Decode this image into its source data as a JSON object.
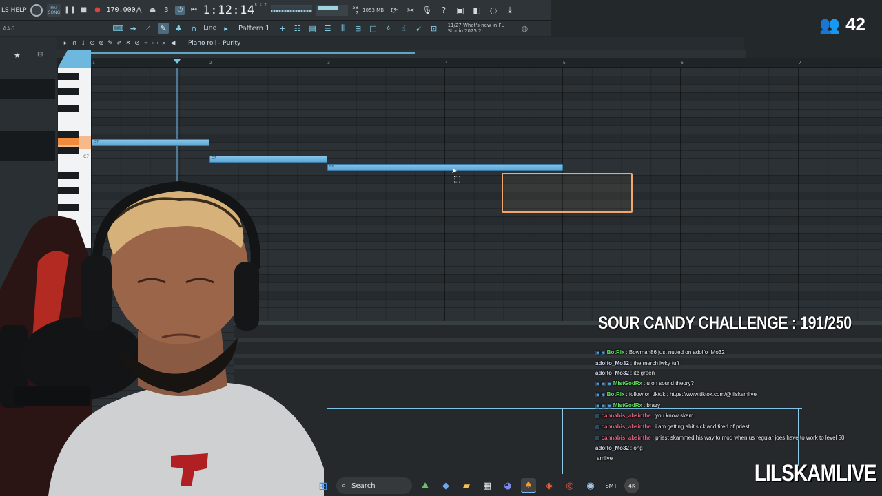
{
  "overlay": {
    "viewer_count": "42",
    "challenge": "SOUR CANDY CHALLENGE : 191/250",
    "brand": "LILSKAMLIVE"
  },
  "fl": {
    "menu_help": "LS HELP",
    "pat_label": "PAT",
    "song_label": "SONG",
    "tempo": "170.000",
    "time": "1:12:14",
    "time_unit": "B:S:T",
    "cpu_value": "58",
    "ram_value": "1053 MB",
    "polyphony": "7",
    "note_indicator": "A#6",
    "snap": "Line",
    "pattern": "Pattern 1",
    "news_date": "11/27",
    "news_line1": "What's new in FL",
    "news_line2": "Studio 2025.2",
    "piano_roll_title": "Piano roll - Purity"
  },
  "ruler": [
    "1",
    "2",
    "3",
    "4",
    "5",
    "6",
    "7"
  ],
  "keyboard": {
    "label_c7": "C7"
  },
  "notes": [
    {
      "label": "D7"
    },
    {
      "label": "C7"
    },
    {
      "label": "B6"
    }
  ],
  "chat": [
    {
      "badges": "▣ ◉",
      "user": "BotRix",
      "color": "#5ee35e",
      "msg": ": Bowman86 just nutted on adolfo_Mo32"
    },
    {
      "badges": "",
      "user": "adolfo_Mo32",
      "color": "#cdd3e8",
      "msg": ": the merch lwky tuff"
    },
    {
      "badges": "",
      "user": "adolfo_Mo32",
      "color": "#cdd3e8",
      "msg": ": itz green"
    },
    {
      "badges": "▣ ▣ ▣",
      "user": "MistGodRx",
      "color": "#5ee35e",
      "msg": ": u on sound theory?"
    },
    {
      "badges": "▣ ◉",
      "user": "BotRix",
      "color": "#5ee35e",
      "msg": ": follow on tiktok : https://www.tiktok.com/@lilskamlive"
    },
    {
      "badges": "▣ ▣ ▣",
      "user": "MistGodRx",
      "color": "#5ee35e",
      "msg": ": brazy"
    },
    {
      "badges": "▤",
      "user": "cannabis_absinthe",
      "color": "#e0607e",
      "msg": ": you know skam"
    },
    {
      "badges": "▤",
      "user": "cannabis_absinthe",
      "color": "#e0607e",
      "msg": ": i am getting abit sick and tired of priest"
    },
    {
      "badges": "▤",
      "user": "cannabis_absinthe",
      "color": "#e0607e",
      "msg": ": priest skammed his way to mod when us regular joes have to work to level 50"
    },
    {
      "badges": "",
      "user": "adolfo_Mo32",
      "color": "#cdd3e8",
      "msg": ": ong"
    },
    {
      "badges": "",
      "user": "",
      "color": "#ffffff",
      "msg": "amlive"
    }
  ],
  "taskbar": {
    "search": "Search",
    "apps": [
      "edge-like",
      "folder",
      "store",
      "discord",
      "fl-studio",
      "brave",
      "chrome",
      "steam",
      "app",
      "4k"
    ]
  }
}
